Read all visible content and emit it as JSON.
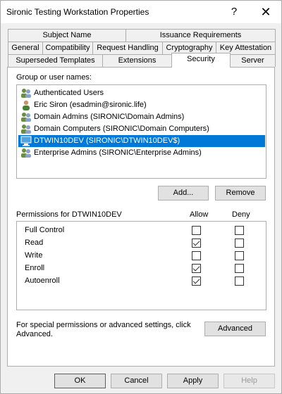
{
  "window": {
    "title": "Sironic Testing Workstation Properties",
    "help_glyph": "?",
    "close_glyph": "✕"
  },
  "tabs": {
    "row1": [
      "Subject Name",
      "Issuance Requirements"
    ],
    "row2": [
      "General",
      "Compatibility",
      "Request Handling",
      "Cryptography",
      "Key Attestation"
    ],
    "row3": [
      "Superseded Templates",
      "Extensions",
      "Security",
      "Server"
    ],
    "active": "Security"
  },
  "security": {
    "group_label": "Group or user names:",
    "principals": [
      {
        "name": "Authenticated Users",
        "icon": "group-icon"
      },
      {
        "name": "Eric Siron (esadmin@sironic.life)",
        "icon": "user-icon"
      },
      {
        "name": "Domain Admins (SIRONIC\\Domain Admins)",
        "icon": "group-icon"
      },
      {
        "name": "Domain Computers (SIRONIC\\Domain Computers)",
        "icon": "group-icon"
      },
      {
        "name": "DTWIN10DEV (SIRONIC\\DTWIN10DEV$)",
        "icon": "computer-icon",
        "selected": true
      },
      {
        "name": "Enterprise Admins (SIRONIC\\Enterprise Admins)",
        "icon": "group-icon"
      }
    ],
    "add_label": "Add...",
    "remove_label": "Remove",
    "permissions_label": "Permissions for DTWIN10DEV",
    "allow_label": "Allow",
    "deny_label": "Deny",
    "permissions": [
      {
        "name": "Full Control",
        "allow": false,
        "deny": false
      },
      {
        "name": "Read",
        "allow": true,
        "deny": false
      },
      {
        "name": "Write",
        "allow": false,
        "deny": false
      },
      {
        "name": "Enroll",
        "allow": true,
        "deny": false
      },
      {
        "name": "Autoenroll",
        "allow": true,
        "deny": false
      }
    ],
    "advanced_text": "For special permissions or advanced settings, click Advanced.",
    "advanced_label": "Advanced"
  },
  "footer": {
    "ok": "OK",
    "cancel": "Cancel",
    "apply": "Apply",
    "help": "Help"
  },
  "colors": {
    "selection": "#0078d7",
    "window_bg": "#f0f0f0",
    "group_icon": "#6b8f3e",
    "user_icon": "#4a7f3a",
    "computer_icon": "#4fa3e0"
  }
}
